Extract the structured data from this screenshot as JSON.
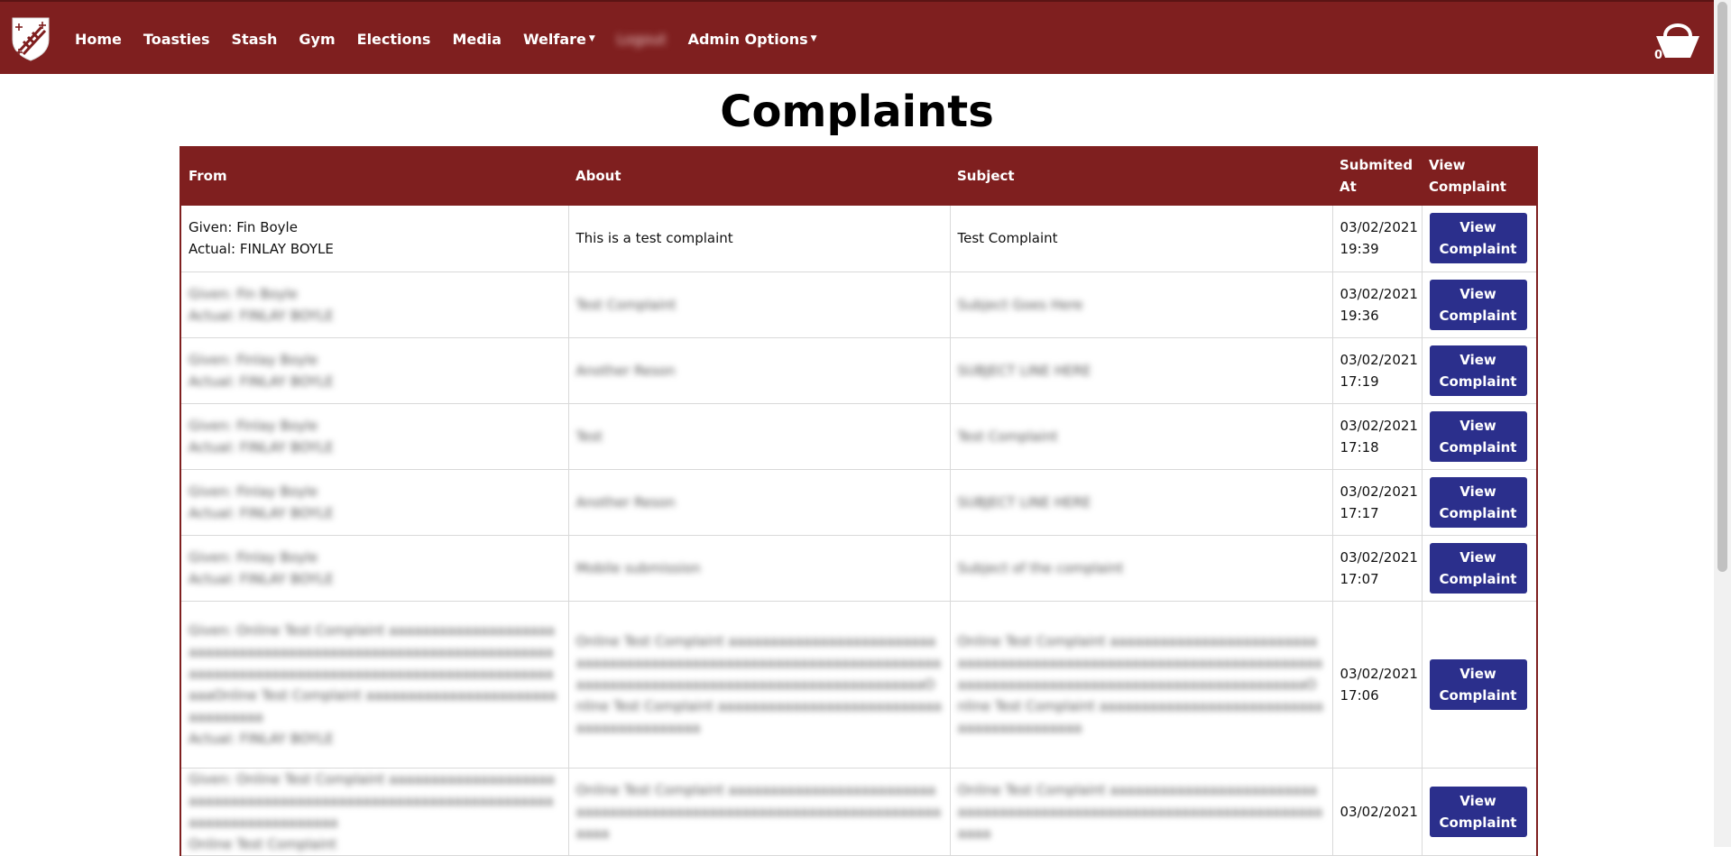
{
  "nav": {
    "items": [
      {
        "label": "Home"
      },
      {
        "label": "Toasties"
      },
      {
        "label": "Stash"
      },
      {
        "label": "Gym"
      },
      {
        "label": "Elections"
      },
      {
        "label": "Media"
      },
      {
        "label": "Welfare",
        "dropdown": true
      },
      {
        "label": "Logout",
        "dropdown": false,
        "blurred": true
      },
      {
        "label": "Admin Options",
        "dropdown": true
      }
    ],
    "basket_count": "0"
  },
  "page": {
    "title": "Complaints"
  },
  "table": {
    "headers": {
      "from": "From",
      "about": "About",
      "subject": "Subject",
      "submitted": "Submited At",
      "view": "View Complaint"
    },
    "rows": [
      {
        "from_given": "Given: Fin Boyle",
        "from_actual": "Actual: FINLAY BOYLE",
        "about": "This is a test complaint",
        "subject": "Test Complaint",
        "date": "03/02/2021",
        "time": "19:39",
        "button": "View Complaint",
        "blurred": false
      },
      {
        "from_given": "Given: Fin Boyle",
        "from_actual": "Actual: FINLAY BOYLE",
        "about": "Test Complaint",
        "subject": "Subject Goes Here",
        "date": "03/02/2021",
        "time": "19:36",
        "button": "View Complaint",
        "blurred": true
      },
      {
        "from_given": "Given: Finlay Boyle",
        "from_actual": "Actual: FINLAY BOYLE",
        "about": "Another Reson",
        "subject": "SUBJECT LINE HERE",
        "date": "03/02/2021",
        "time": "17:19",
        "button": "View Complaint",
        "blurred": true
      },
      {
        "from_given": "Given: Finlay Boyle",
        "from_actual": "Actual: FINLAY BOYLE",
        "about": "Test",
        "subject": "Test Complaint",
        "date": "03/02/2021",
        "time": "17:18",
        "button": "View Complaint",
        "blurred": true
      },
      {
        "from_given": "Given: Finlay Boyle",
        "from_actual": "Actual: FINLAY BOYLE",
        "about": "Another Reson",
        "subject": "SUBJECT LINE HERE",
        "date": "03/02/2021",
        "time": "17:17",
        "button": "View Complaint",
        "blurred": true
      },
      {
        "from_given": "Given: Finlay Boyle",
        "from_actual": "Actual: FINLAY BOYLE",
        "about": "Mobile submission",
        "subject": "Subject of the complaint",
        "date": "03/02/2021",
        "time": "17:07",
        "button": "View Complaint",
        "blurred": true
      },
      {
        "from_given": "Given: Online Test Complaint aaaaaaaaaaaaaaaaaaaaaaaaaaaaaaaaaaaaaaaaaaaaaaaaaaaaaaaaaaaaaaaaaaaaaaaaaaaaaaaaaaaaaaaaaaaaaaaaaaaaaaaaaaaaaaaOnline Test Complaint aaaaaaaaaaaaaaaaaaaaaaaaaaaaaaaa",
        "from_actual": "Actual: FINLAY BOYLE",
        "about": "Online Test Complaint aaaaaaaaaaaaaaaaaaaaaaaaaaaaaaaaaaaaaaaaaaaaaaaaaaaaaaaaaaaaaaaaaaaaaaaaaaaaaaaaaaaaaaaaaaaaaaaaaaaaaaaaaaaaaaaOnline Test Complaint aaaaaaaaaaaaaaaaaaaaaaaaaaaaaaaaaaaaaaaaaa",
        "subject": "Online Test Complaint aaaaaaaaaaaaaaaaaaaaaaaaaaaaaaaaaaaaaaaaaaaaaaaaaaaaaaaaaaaaaaaaaaaaaaaaaaaaaaaaaaaaaaaaaaaaaaaaaaaaaaaaaaaaaaaOnline Test Complaint aaaaaaaaaaaaaaaaaaaaaaaaaaaaaaaaaaaaaaaaaa",
        "date": "03/02/2021",
        "time": "17:06",
        "button": "View Complaint",
        "blurred": true
      },
      {
        "from_given": "Given: Online Test Complaint aaaaaaaaaaaaaaaaaaaaaaaaaaaaaaaaaaaaaaaaaaaaaaaaaaaaaaaaaaaaaaaaaaaaaaaaaaaaaaaaaa",
        "from_actual": "Online Test Complaint",
        "about": "Online Test Complaint aaaaaaaaaaaaaaaaaaaaaaaaaaaaaaaaaaaaaaaaaaaaaaaaaaaaaaaaaaaaaaaaaaaaaaaaa",
        "subject": "Online Test Complaint aaaaaaaaaaaaaaaaaaaaaaaaaaaaaaaaaaaaaaaaaaaaaaaaaaaaaaaaaaaaaaaaaaaaaaaaa",
        "date": "03/02/2021",
        "time": "",
        "button": "View Complaint",
        "blurred": true
      }
    ]
  }
}
